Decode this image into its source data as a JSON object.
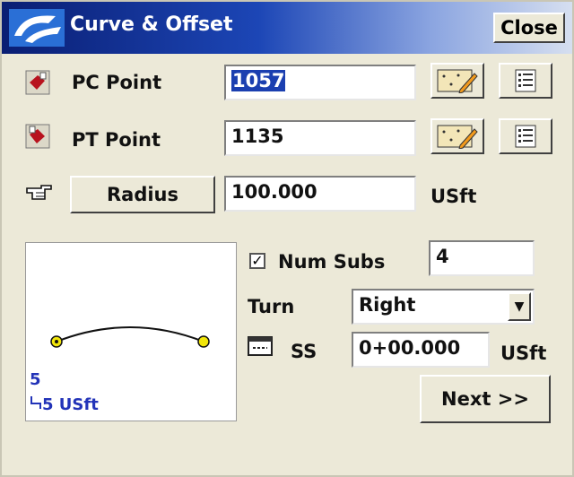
{
  "window": {
    "title": "Curve & Offset",
    "close_label": "Close"
  },
  "pc_point": {
    "label": "PC Point",
    "value": "1057"
  },
  "pt_point": {
    "label": "PT Point",
    "value": "1135"
  },
  "radius": {
    "button_label": "Radius",
    "value": "100.000",
    "unit": "USft"
  },
  "preview": {
    "scale_value": "5",
    "scale_label": "5 USft"
  },
  "num_subs": {
    "label": "Num Subs",
    "checked": true,
    "value": "4"
  },
  "turn": {
    "label": "Turn",
    "selected": "Right"
  },
  "ss": {
    "label": "SS",
    "value": "0+00.000",
    "unit": "USft"
  },
  "next_label": "Next >>",
  "colors": {
    "title_bar": "#0a1e73",
    "selection": "#1b3fb0",
    "scale_text": "#2233b8",
    "point_fill": "#f2e60a"
  }
}
